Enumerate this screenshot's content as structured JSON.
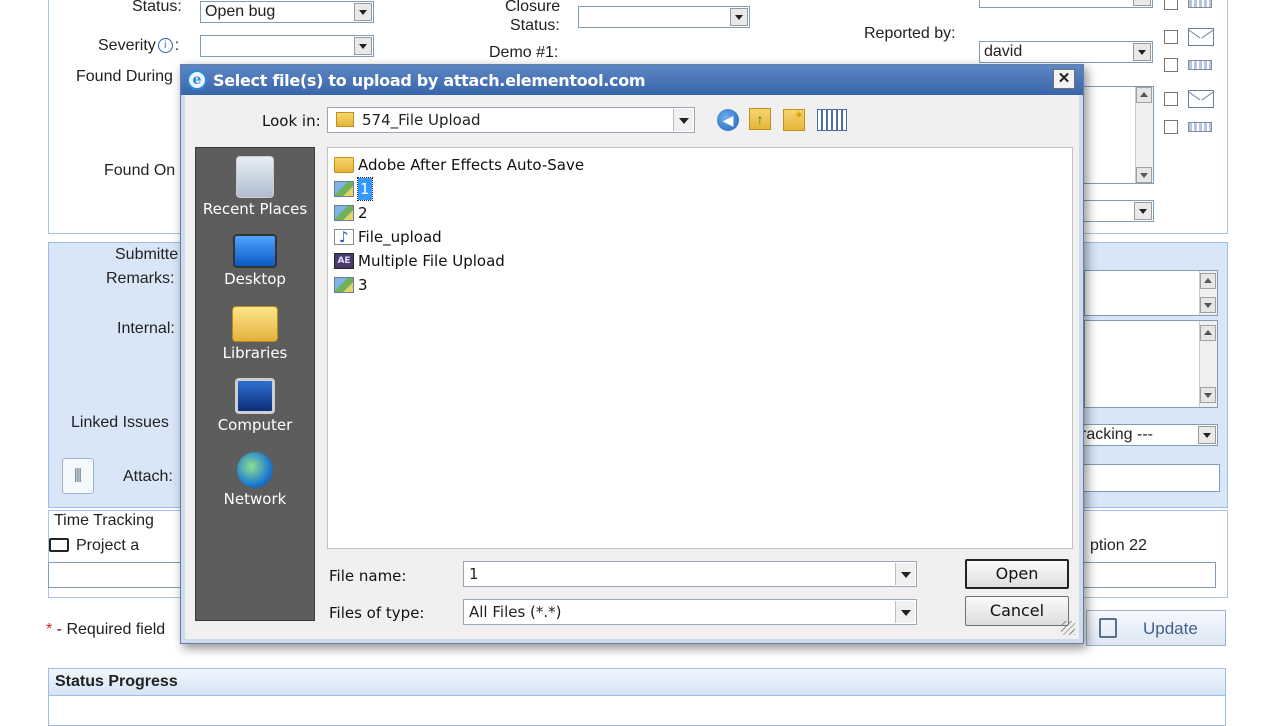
{
  "form": {
    "status_label": "Status:",
    "status_value": "Open bug",
    "severity_label": "Severity",
    "severity_colon": ":",
    "closure_label_1": "Closure",
    "closure_label_2": "Status:",
    "demo_label": "Demo #1:",
    "reported_by_label": "Reported by:",
    "reported_by_value": "david",
    "found_during_label": "Found During",
    "found_on_label": "Found On",
    "submitted_label": "Submitte",
    "remarks_label": "Remarks:",
    "internal_label": "Internal:",
    "linked_issues_label": "Linked Issues",
    "tracking_value": "racking ---",
    "attach_label": "Attach:",
    "time_tracking_label": "Time Tracking",
    "project_label": "Project a",
    "option_label": "ption 22",
    "required_star": "*",
    "required_text": " - Required field",
    "update_label": "Update",
    "status_progress_label": "Status Progress"
  },
  "dialog": {
    "title": "Select file(s) to upload by attach.elementool.com",
    "close_glyph": "✕",
    "look_in_label": "Look in:",
    "look_in_value": "574_File Upload",
    "places": [
      {
        "label": "Recent Places",
        "icon": "recent-places-icon"
      },
      {
        "label": "Desktop",
        "icon": "desktop-icon"
      },
      {
        "label": "Libraries",
        "icon": "libraries-icon"
      },
      {
        "label": "Computer",
        "icon": "computer-icon"
      },
      {
        "label": "Network",
        "icon": "network-icon"
      }
    ],
    "files": [
      {
        "name": "Adobe After Effects Auto-Save",
        "type": "folder"
      },
      {
        "name": "1",
        "type": "image",
        "selected": true
      },
      {
        "name": "2",
        "type": "image"
      },
      {
        "name": "File_upload",
        "type": "audio"
      },
      {
        "name": "Multiple File Upload",
        "type": "after-effects"
      },
      {
        "name": "3",
        "type": "image"
      }
    ],
    "file_name_label": "File name:",
    "file_name_value": "1",
    "files_of_type_label": "Files of type:",
    "files_of_type_value": "All Files (*.*)",
    "open_label": "Open",
    "cancel_label": "Cancel"
  },
  "colors": {
    "titlebar": "#3865ab",
    "form_panel": "#d9e6f7",
    "places_bg": "#5d5d5d",
    "selection": "#3399ff"
  }
}
